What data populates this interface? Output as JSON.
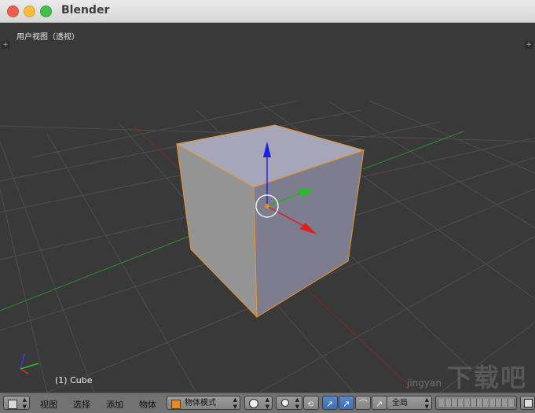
{
  "window": {
    "title": "Blender"
  },
  "viewport": {
    "view_name": "用户视图（透视）",
    "object_label": "(1) Cube"
  },
  "header": {
    "menus": [
      "视图",
      "选择",
      "添加",
      "物体"
    ],
    "mode": "物体模式",
    "orientation": "全局"
  },
  "watermark": {
    "site": "jingyan",
    "logo": "下载吧"
  }
}
